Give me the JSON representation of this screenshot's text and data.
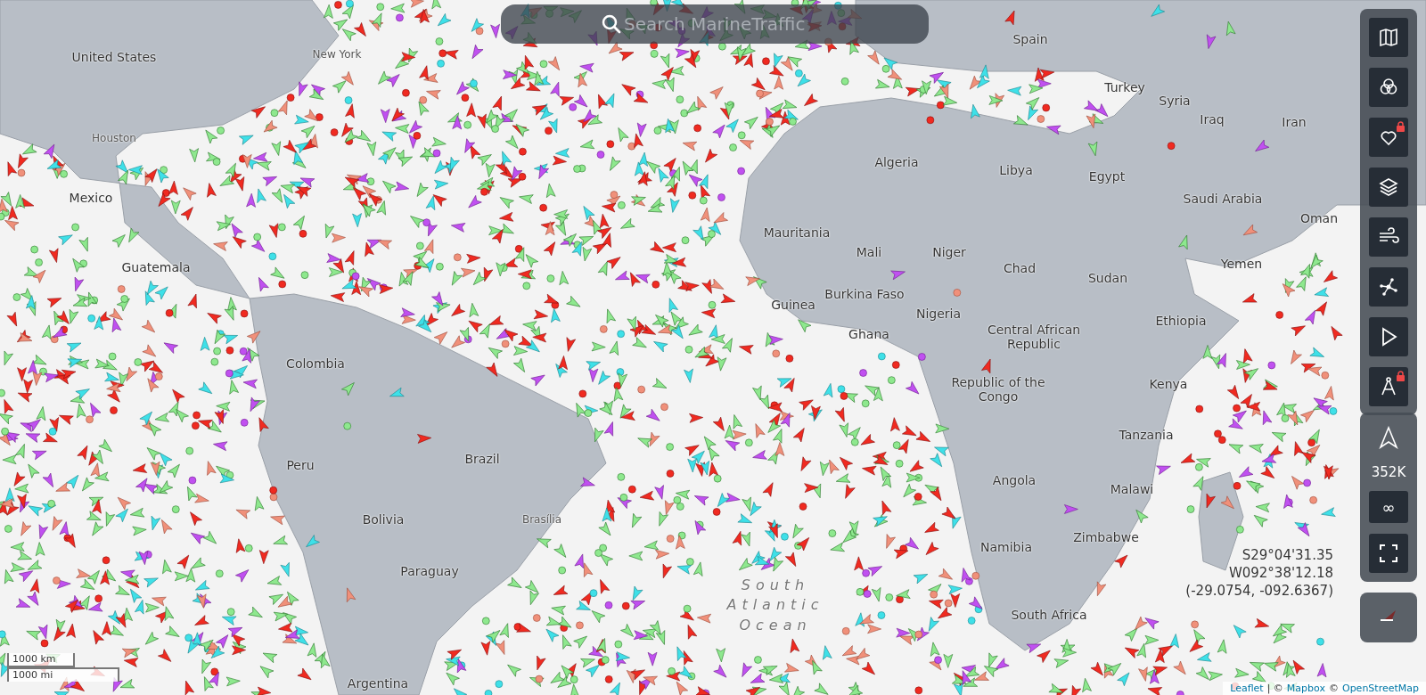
{
  "search": {
    "placeholder": "Search MarineTraffic"
  },
  "map_labels": [
    {
      "text": "United States",
      "kind": "country"
    },
    {
      "text": "New York",
      "kind": "city"
    },
    {
      "text": "Houston",
      "kind": "city"
    },
    {
      "text": "Mexico",
      "kind": "country"
    },
    {
      "text": "Guatemala",
      "kind": "country"
    },
    {
      "text": "Colombia",
      "kind": "country"
    },
    {
      "text": "Peru",
      "kind": "country"
    },
    {
      "text": "Brazil",
      "kind": "country"
    },
    {
      "text": "Bolivia",
      "kind": "country"
    },
    {
      "text": "Brasília",
      "kind": "city"
    },
    {
      "text": "Paraguay",
      "kind": "country"
    },
    {
      "text": "Argentina",
      "kind": "country"
    },
    {
      "text": "Spain",
      "kind": "country"
    },
    {
      "text": "Algeria",
      "kind": "country"
    },
    {
      "text": "Libya",
      "kind": "country"
    },
    {
      "text": "Egypt",
      "kind": "country"
    },
    {
      "text": "Mauritania",
      "kind": "country"
    },
    {
      "text": "Mali",
      "kind": "country"
    },
    {
      "text": "Niger",
      "kind": "country"
    },
    {
      "text": "Chad",
      "kind": "country"
    },
    {
      "text": "Sudan",
      "kind": "country"
    },
    {
      "text": "Burkina Faso",
      "kind": "country"
    },
    {
      "text": "Guinea",
      "kind": "country"
    },
    {
      "text": "Nigeria",
      "kind": "country"
    },
    {
      "text": "Ghana",
      "kind": "country"
    },
    {
      "text": "Central African Republic",
      "kind": "country"
    },
    {
      "text": "Ethiopia",
      "kind": "country"
    },
    {
      "text": "Republic of the Congo",
      "kind": "country"
    },
    {
      "text": "Kenya",
      "kind": "country"
    },
    {
      "text": "Tanzania",
      "kind": "country"
    },
    {
      "text": "Angola",
      "kind": "country"
    },
    {
      "text": "Malawi",
      "kind": "country"
    },
    {
      "text": "Zimbabwe",
      "kind": "country"
    },
    {
      "text": "Namibia",
      "kind": "country"
    },
    {
      "text": "South Africa",
      "kind": "country"
    },
    {
      "text": "Turkey",
      "kind": "country"
    },
    {
      "text": "Syria",
      "kind": "country"
    },
    {
      "text": "Iraq",
      "kind": "country"
    },
    {
      "text": "Iran",
      "kind": "country"
    },
    {
      "text": "Saudi Arabia",
      "kind": "country"
    },
    {
      "text": "Oman",
      "kind": "country"
    },
    {
      "text": "Yemen",
      "kind": "country"
    },
    {
      "text": "South Atlantic Ocean",
      "kind": "ocean"
    }
  ],
  "toolbar": {
    "buttons": [
      {
        "kind": "map",
        "locked": false
      },
      {
        "kind": "filters",
        "locked": false
      },
      {
        "kind": "favorites",
        "locked": true
      },
      {
        "kind": "layers",
        "locked": false
      },
      {
        "kind": "weather",
        "locked": false
      },
      {
        "kind": "tracks",
        "locked": false
      },
      {
        "kind": "playback",
        "locked": false
      },
      {
        "kind": "measure",
        "locked": true
      }
    ]
  },
  "vessel_panel": {
    "count": "352K",
    "infinity": "∞"
  },
  "coordinates": [
    "S29°04'31.35",
    "W092°38'12.18",
    "(-29.0754, -092.6367)"
  ],
  "scale": [
    "1000 km",
    "1000 mi"
  ],
  "attribution": [
    {
      "text": "Leaflet",
      "kind": "link"
    },
    {
      "text": "| ©",
      "kind": "text"
    },
    {
      "text": "Mapbox",
      "kind": "link"
    },
    {
      "text": "©",
      "kind": "text"
    },
    {
      "text": "OpenStreetMap",
      "kind": "link"
    }
  ]
}
